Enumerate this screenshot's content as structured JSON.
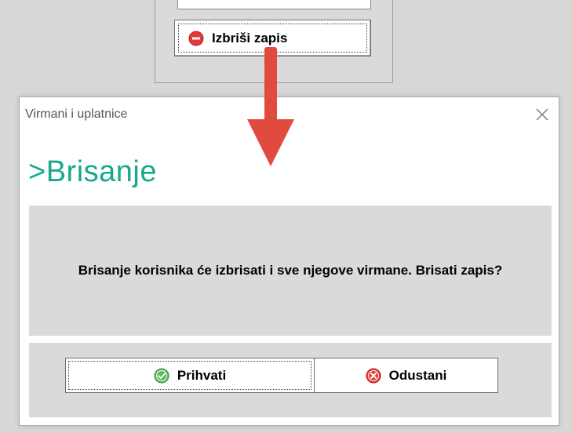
{
  "background_form": {
    "delete_button_label": "Izbriši zapis"
  },
  "dialog": {
    "window_title": "Virmani i uplatnice",
    "heading": ">Brisanje",
    "message": "Brisanje korisnika će izbrisati i sve njegove virmane. Brisati zapis?",
    "accept_label": "Prihvati",
    "cancel_label": "Odustani"
  },
  "colors": {
    "heading": "#18a88c",
    "arrow": "#e04a3f",
    "accept_icon": "#4caf50",
    "cancel_icon": "#e53935",
    "delete_icon": "#e53935"
  }
}
